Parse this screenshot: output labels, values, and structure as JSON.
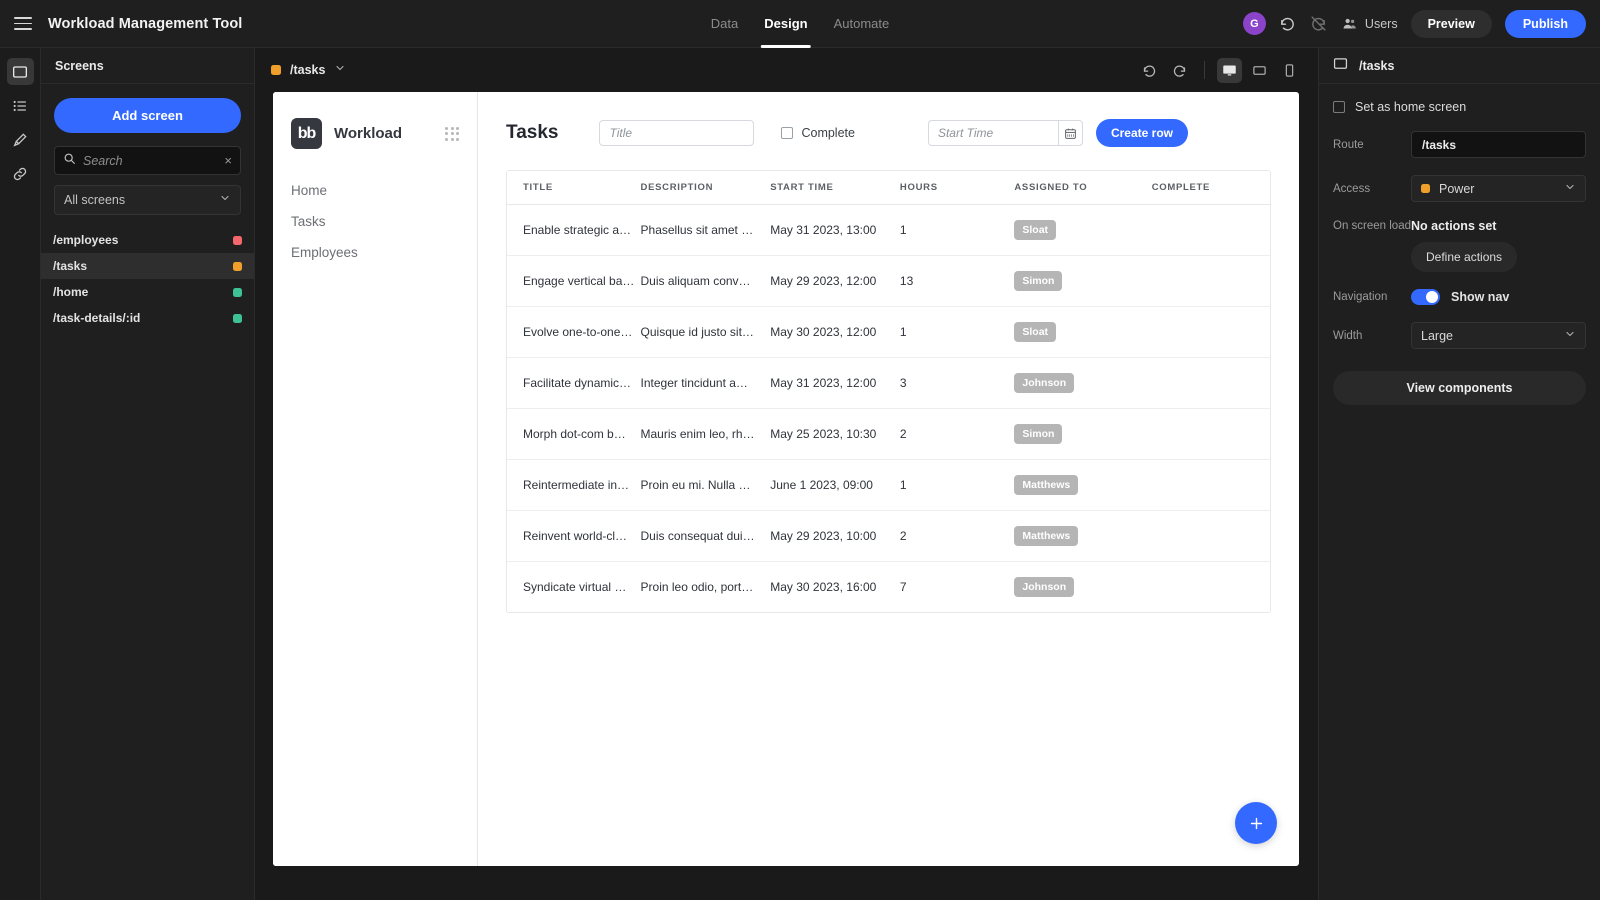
{
  "topbar": {
    "menu_icon": "hamburger-icon",
    "title": "Workload Management Tool",
    "nav": [
      {
        "label": "Data",
        "active": false
      },
      {
        "label": "Design",
        "active": true
      },
      {
        "label": "Automate",
        "active": false
      }
    ],
    "avatar_initial": "G",
    "avatar_color": "#8b43c9",
    "undo_icon": "undo-icon",
    "redo_icon": "redo-disabled-icon",
    "users_icon": "users-icon",
    "users_label": "Users",
    "preview_label": "Preview",
    "publish_label": "Publish",
    "publish_color": "#3369ff"
  },
  "rail": [
    {
      "icon": "screen-icon",
      "active": true
    },
    {
      "icon": "list-icon",
      "active": false
    },
    {
      "icon": "brush-icon",
      "active": false
    },
    {
      "icon": "link-icon",
      "active": false
    }
  ],
  "screens_panel": {
    "heading": "Screens",
    "add_button": "Add screen",
    "search_placeholder": "Search",
    "clear_icon": "close-icon",
    "filter_value": "All screens",
    "items": [
      {
        "name": "/employees",
        "color": "#f2686d",
        "selected": false
      },
      {
        "name": "/tasks",
        "color": "#f0a02a",
        "selected": true
      },
      {
        "name": "/home",
        "color": "#3ec295",
        "selected": false
      },
      {
        "name": "/task-details/:id",
        "color": "#3ec295",
        "selected": false
      }
    ]
  },
  "canvas": {
    "route_label": "/tasks",
    "route_color": "#f0a02a",
    "chevron_icon": "chevron-down-icon",
    "undo_icon": "undo-icon",
    "redo_icon": "redo-icon",
    "devices": [
      {
        "icon": "desktop-icon",
        "selected": true
      },
      {
        "icon": "tablet-icon",
        "selected": false
      },
      {
        "icon": "mobile-icon",
        "selected": false
      }
    ]
  },
  "app": {
    "logo_text": "bb",
    "brand": "Workload",
    "grip_icon": "drag-grip-icon",
    "nav_links": [
      "Home",
      "Tasks",
      "Employees"
    ],
    "page_title": "Tasks",
    "title_filter_placeholder": "Title",
    "complete_label": "Complete",
    "start_time_placeholder": "Start Time",
    "calendar_icon": "calendar-icon",
    "create_row_label": "Create row",
    "fab_icon": "plus-icon",
    "table": {
      "columns": [
        "TITLE",
        "DESCRIPTION",
        "START TIME",
        "HOURS",
        "ASSIGNED TO",
        "COMPLETE"
      ],
      "rows": [
        {
          "title": "Enable strategic a…",
          "description": "Phasellus sit amet …",
          "start_time": "May 31 2023, 13:00",
          "hours": "1",
          "assigned_to": "Sloat",
          "complete": ""
        },
        {
          "title": "Engage vertical ba…",
          "description": "Duis aliquam conv…",
          "start_time": "May 29 2023, 12:00",
          "hours": "13",
          "assigned_to": "Simon",
          "complete": ""
        },
        {
          "title": "Evolve one-to-one…",
          "description": "Quisque id justo sit…",
          "start_time": "May 30 2023, 12:00",
          "hours": "1",
          "assigned_to": "Sloat",
          "complete": ""
        },
        {
          "title": "Facilitate dynamic…",
          "description": "Integer tincidunt a…",
          "start_time": "May 31 2023, 12:00",
          "hours": "3",
          "assigned_to": "Johnson",
          "complete": ""
        },
        {
          "title": "Morph dot-com b…",
          "description": "Mauris enim leo, rh…",
          "start_time": "May 25 2023, 10:30",
          "hours": "2",
          "assigned_to": "Simon",
          "complete": ""
        },
        {
          "title": "Reintermediate in…",
          "description": "Proin eu mi. Nulla …",
          "start_time": "June 1 2023, 09:00",
          "hours": "1",
          "assigned_to": "Matthews",
          "complete": ""
        },
        {
          "title": "Reinvent world-cl…",
          "description": "Duis consequat dui…",
          "start_time": "May 29 2023, 10:00",
          "hours": "2",
          "assigned_to": "Matthews",
          "complete": ""
        },
        {
          "title": "Syndicate virtual …",
          "description": "Proin leo odio, port…",
          "start_time": "May 30 2023, 16:00",
          "hours": "7",
          "assigned_to": "Johnson",
          "complete": ""
        }
      ]
    }
  },
  "right_panel": {
    "screen_icon": "screen-icon",
    "title": "/tasks",
    "home_checkbox_label": "Set as home screen",
    "route_label": "Route",
    "route_value": "/tasks",
    "access_label": "Access",
    "access_value": "Power",
    "access_color": "#f0a02a",
    "onload_label": "On screen load",
    "onload_value": "No actions set",
    "define_actions_label": "Define actions",
    "navigation_label": "Navigation",
    "show_nav_label": "Show nav",
    "show_nav_on": true,
    "width_label": "Width",
    "width_value": "Large",
    "view_components_label": "View components"
  }
}
